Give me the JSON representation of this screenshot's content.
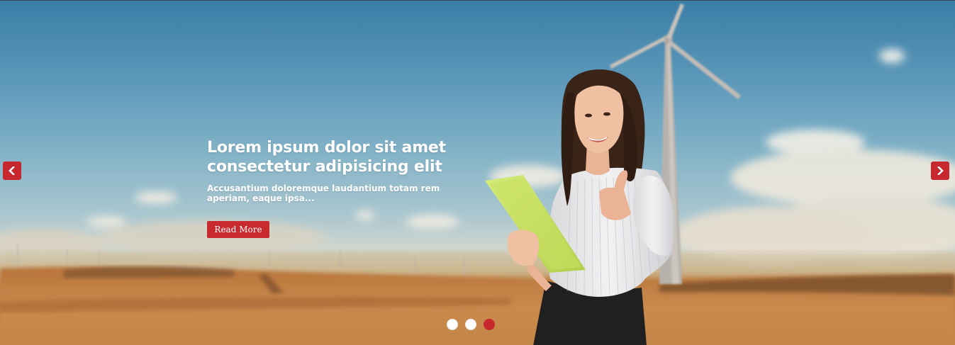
{
  "slide": {
    "title_line1": "Lorem ipsum dolor sit amet",
    "title_line2": "consectetur adipisicing elit",
    "description": "Accusantium doloremque laudantium totam rem aperiam, eaque ipsa...",
    "cta_label": "Read More"
  },
  "navigation": {
    "prev_icon": "chevron-left-icon",
    "next_icon": "chevron-right-icon"
  },
  "pagination": {
    "count": 3,
    "active_index": 2
  },
  "colors": {
    "accent": "#c7282e",
    "text_on_image": "#ffffff"
  },
  "background": {
    "scene": "wind turbine over wheat field, woman holding green folder giving thumbs up"
  }
}
